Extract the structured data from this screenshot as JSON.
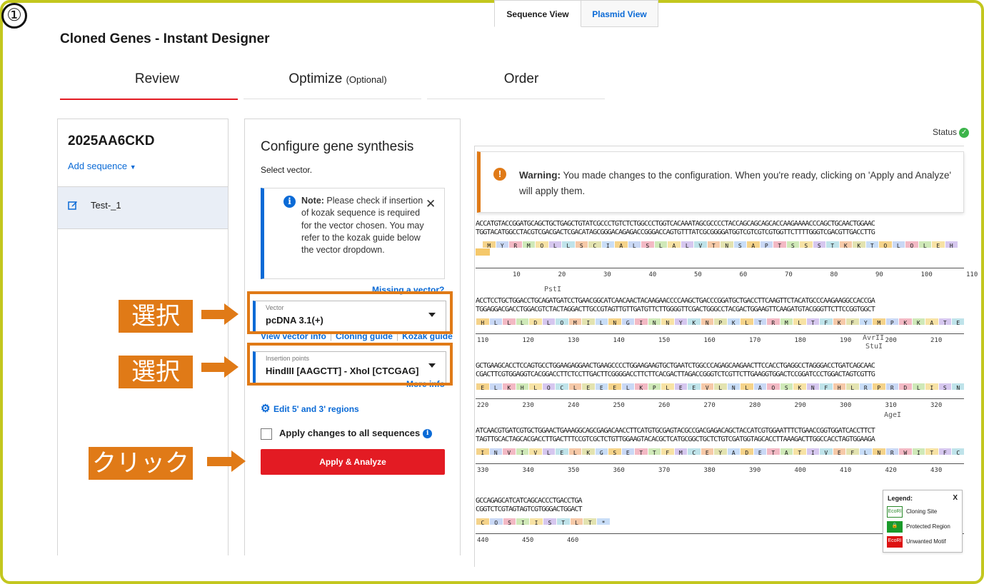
{
  "step_number": "①",
  "app_title": "Cloned Genes - Instant Designer",
  "tabs": [
    {
      "label": "Review",
      "sub": ""
    },
    {
      "label": "Optimize",
      "sub": "(Optional)"
    },
    {
      "label": "Order",
      "sub": ""
    }
  ],
  "left": {
    "job_id": "2025AA6CKD",
    "add_sequence": "Add sequence",
    "sequence_name": "Test-_1"
  },
  "config": {
    "title": "Configure gene synthesis",
    "select_vector": "Select vector.",
    "note_bold": "Note:",
    "note_text": " Please check if insertion of kozak sequence is required for the vector chosen. You may refer to the kozak guide below the vector dropdown.",
    "missing_vector": "Missing a vector?",
    "vector_label": "Vector",
    "vector_value": "pcDNA 3.1(+)",
    "links": [
      "View vector info",
      "Cloning guide",
      "Kozak guide"
    ],
    "insertion_label": "Insertion points",
    "insertion_value": "HindIII [AAGCTT] - XhoI [CTCGAG]",
    "more_info": "More info",
    "edit_regions": "Edit 5' and 3' regions",
    "apply_all": "Apply changes to all sequences",
    "apply_button": "Apply & Analyze"
  },
  "callouts": {
    "select1": "選択",
    "select2": "選択",
    "click": "クリック"
  },
  "colors": {
    "accent_red": "#e31b23",
    "accent_blue": "#0a6ad6",
    "callout_orange": "#e07a17",
    "frame": "#c3c71e"
  },
  "right": {
    "tab_sequence": "Sequence View",
    "tab_plasmid": "Plasmid View",
    "status": "Status",
    "warning_bold": "Warning:",
    "warning_text": " You made changes to the configuration. When you're ready, clicking on 'Apply and Analyze' will apply them.",
    "blocks": [
      {
        "top": "ACCATGTACCGGATGCAGCTGCTGAGCTGTATCGCCCTGTCTCTGGCCCTGGTCACAAATAGCGCCCCTACCAGCAGCAGCACCAAGAAAACCCAGCTGCAACTGGAAC",
        "bottom": "TGGTACATGGCCTACGTCGACGACTCGACATAGCGGGACAGAGACCGGGACCAGTGTTTATCGCGGGGATGGTCGTCGTCGTGGTTCTTTTGGGTCGACGTTGACCTTG",
        "aa": [
          "M",
          "Y",
          "R",
          "M",
          "Q",
          "L",
          "L",
          "S",
          "C",
          "I",
          "A",
          "L",
          "S",
          "L",
          "A",
          "L",
          "V",
          "T",
          "N",
          "S",
          "A",
          "P",
          "T",
          "S",
          "S",
          "S",
          "T",
          "K",
          "K",
          "T",
          "Q",
          "L",
          "Q",
          "L",
          "E",
          "H"
        ],
        "ticks": [
          "10",
          "20",
          "30",
          "40",
          "50",
          "60",
          "70",
          "80",
          "90",
          "100",
          "110"
        ],
        "sites": []
      },
      {
        "top": "ACCTCCTGCTGGACCTGCAGATGATCCTGAACGGCATCAACAACTACAAGAACCCCAAGCTGACCCGGATGCTGACCTTCAAGTTCTACATGCCCAAGAAGGCCACCGA",
        "bottom": "TGGAGGACGACCTGGACGTCTACTAGGACTTGCCGTAGTTGTTGATGTTCTTGGGGTTCGACTGGGCCTACGACTGGAAGTTCAAGATGTACGGGTTCTTCCGGTGGCT",
        "aa": [
          "H",
          "L",
          "L",
          "L",
          "D",
          "L",
          "Q",
          "M",
          "I",
          "L",
          "N",
          "G",
          "I",
          "N",
          "N",
          "Y",
          "K",
          "N",
          "P",
          "K",
          "L",
          "T",
          "R",
          "M",
          "L",
          "T",
          "F",
          "K",
          "F",
          "Y",
          "M",
          "P",
          "K",
          "K",
          "A",
          "T",
          "E"
        ],
        "ticks": [
          "110",
          "120",
          "130",
          "140",
          "150",
          "160",
          "170",
          "180",
          "190",
          "200",
          "210"
        ],
        "sites": [
          "PstI"
        ]
      },
      {
        "top": "GCTGAAGCACCTCCAGTGCCTGGAAGAGGAACTGAAGCCCCTGGAAGAAGTGCTGAATCTGGCCCAGAGCAAGAACTTCCACCTGAGGCCTAGGGACCTGATCAGCAAC",
        "bottom": "CGACTTCGTGGAGGTCACGGACCTTCTCCTTGACTTCGGGGACCTTCTTCACGACTTAGACCGGGTCTCGTTCTTGAAGGTGGACTCCGGATCCCTGGACTAGTCGTTG",
        "aa": [
          "E",
          "L",
          "K",
          "H",
          "L",
          "Q",
          "C",
          "L",
          "E",
          "E",
          "E",
          "L",
          "K",
          "P",
          "L",
          "E",
          "E",
          "V",
          "L",
          "N",
          "L",
          "A",
          "Q",
          "S",
          "K",
          "N",
          "F",
          "H",
          "L",
          "R",
          "P",
          "R",
          "D",
          "L",
          "I",
          "S",
          "N"
        ],
        "ticks": [
          "220",
          "230",
          "240",
          "250",
          "260",
          "270",
          "280",
          "290",
          "300",
          "310",
          "320"
        ],
        "sites": [
          "AvrII",
          "StuI"
        ]
      },
      {
        "top": "ATCAACGTGATCGTGCTGGAACTGAAAGGCAGCGAGACAACCTTCATGTGCGAGTACGCCGACGAGACAGCTACCATCGTGGAATTTCTGAACCGGTGGATCACCTTCT",
        "bottom": "TAGTTGCACTAGCACGACCTTGACTTTCCGTCGCTCTGTTGGAAGTACACGCTCATGCGGCTGCTCTGTCGATGGTAGCACCTTAAAGACTTGGCCACCTAGTGGAAGA",
        "aa": [
          "I",
          "N",
          "V",
          "I",
          "V",
          "L",
          "E",
          "L",
          "K",
          "G",
          "S",
          "E",
          "T",
          "T",
          "F",
          "M",
          "C",
          "E",
          "Y",
          "A",
          "D",
          "E",
          "T",
          "A",
          "T",
          "I",
          "V",
          "E",
          "F",
          "L",
          "N",
          "R",
          "W",
          "I",
          "T",
          "F",
          "C"
        ],
        "ticks": [
          "330",
          "340",
          "350",
          "360",
          "370",
          "380",
          "390",
          "400",
          "410",
          "420",
          "430"
        ],
        "sites": [
          "AgeI"
        ]
      },
      {
        "top": "GCCAGAGCATCATCAGCACCCTGACCTGA",
        "bottom": "CGGTCTCGTAGTAGTCGTGGGACTGGACT",
        "aa": [
          "C",
          "Q",
          "S",
          "I",
          "I",
          "S",
          "T",
          "L",
          "T",
          "*"
        ],
        "ticks": [
          "440",
          "450",
          "460"
        ],
        "sites": []
      }
    ],
    "legend": {
      "title": "Legend:",
      "close": "X",
      "rows": [
        {
          "tag": "EcoRI",
          "label": "Cloning Site"
        },
        {
          "tag": "",
          "label": "Protected Region"
        },
        {
          "tag": "EcoRI",
          "label": "Unwanted Motif"
        }
      ]
    }
  }
}
